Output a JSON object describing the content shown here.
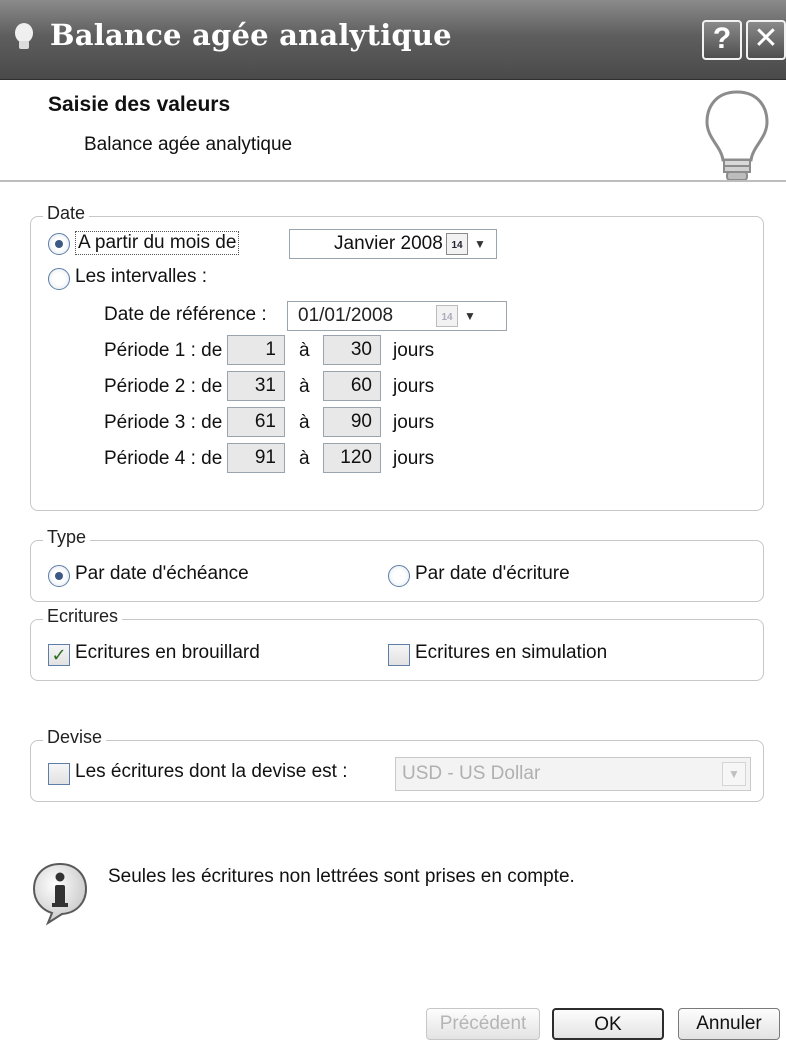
{
  "window": {
    "title": "Balance agée analytique",
    "help_icon": "question-mark",
    "close_icon": "x"
  },
  "header": {
    "title": "Saisie des valeurs",
    "subtitle": "Balance agée analytique",
    "icon": "lightbulb"
  },
  "date_group": {
    "label": "Date",
    "from_month_label": "A partir du mois de",
    "from_month_value": "Janvier 2008",
    "intervals_label": "Les intervalles :",
    "reference_label": "Date de référence :",
    "reference_value": "01/01/2008",
    "calendar_day": "14",
    "periods": [
      {
        "label": "Période 1 : de",
        "from": "1",
        "to": "30"
      },
      {
        "label": "Période 2 : de",
        "from": "31",
        "to": "60"
      },
      {
        "label": "Période 3 : de",
        "from": "61",
        "to": "90"
      },
      {
        "label": "Période 4 : de",
        "from": "91",
        "to": "120"
      }
    ],
    "to_word": "à",
    "unit": "jours"
  },
  "type_group": {
    "label": "Type",
    "option_due": "Par date d'échéance",
    "option_entry": "Par date d'écriture"
  },
  "entries_group": {
    "label": "Ecritures",
    "draft_label": "Ecritures en brouillard",
    "simulation_label": "Ecritures en simulation"
  },
  "currency_group": {
    "label": "Devise",
    "checkbox_label": "Les écritures dont la devise est :",
    "currency_value": "USD - US Dollar"
  },
  "info": {
    "text": "Seules les écritures non lettrées sont prises en compte.",
    "icon": "info-bubble"
  },
  "buttons": {
    "previous": "Précédent",
    "ok": "OK",
    "cancel": "Annuler"
  }
}
